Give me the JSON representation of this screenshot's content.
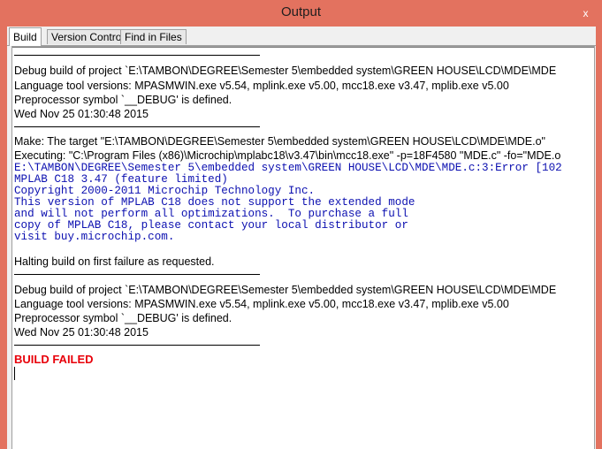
{
  "window": {
    "title": "Output",
    "close_glyph": "x"
  },
  "tabs": [
    {
      "label": "Build",
      "active": true
    },
    {
      "label": "Version Control",
      "active": false
    },
    {
      "label": "Find in Files",
      "active": false
    }
  ],
  "output": {
    "block1": [
      "Debug build of project `E:\\TAMBON\\DEGREE\\Semester 5\\embedded system\\GREEN HOUSE\\LCD\\MDE\\MDE",
      "Language tool versions: MPASMWIN.exe v5.54, mplink.exe v5.00, mcc18.exe v3.47, mplib.exe v5.00",
      "Preprocessor symbol `__DEBUG' is defined.",
      "Wed Nov 25 01:30:48 2015"
    ],
    "block2": [
      "Make: The target \"E:\\TAMBON\\DEGREE\\Semester 5\\embedded system\\GREEN HOUSE\\LCD\\MDE\\MDE.o\"",
      "Executing: \"C:\\Program Files (x86)\\Microchip\\mplabc18\\v3.47\\bin\\mcc18.exe\" -p=18F4580 \"MDE.c\" -fo=\"MDE.o"
    ],
    "compiler": [
      "E:\\TAMBON\\DEGREE\\Semester 5\\embedded system\\GREEN HOUSE\\LCD\\MDE\\MDE.c:3:Error [102",
      "MPLAB C18 3.47 (feature limited)",
      "Copyright 2000-2011 Microchip Technology Inc.",
      "This version of MPLAB C18 does not support the extended mode",
      "and will not perform all optimizations.  To purchase a full",
      "copy of MPLAB C18, please contact your local distributor or",
      "visit buy.microchip.com."
    ],
    "halting": "Halting build on first failure as requested.",
    "block3": [
      "Debug build of project `E:\\TAMBON\\DEGREE\\Semester 5\\embedded system\\GREEN HOUSE\\LCD\\MDE\\MDE",
      "Language tool versions: MPASMWIN.exe v5.54, mplink.exe v5.00, mcc18.exe v3.47, mplib.exe v5.00",
      "Preprocessor symbol `__DEBUG' is defined.",
      "Wed Nov 25 01:30:48 2015"
    ],
    "result": "BUILD FAILED"
  },
  "colors": {
    "window_frame": "#e3725f",
    "compiler_text": "#0b0fb0",
    "failed_text": "#e8000a"
  },
  "icons": {
    "close": "close-icon"
  }
}
